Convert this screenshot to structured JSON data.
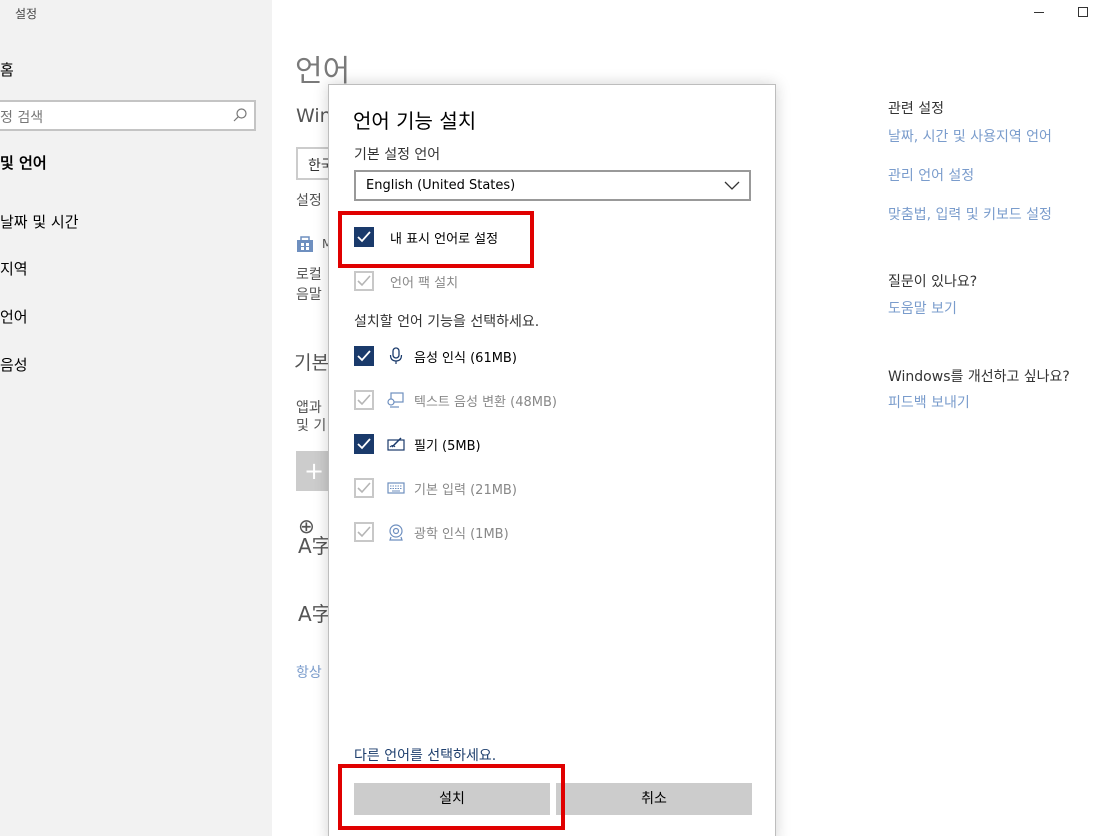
{
  "app": {
    "title": "설정"
  },
  "sidebar": {
    "home": "홈",
    "search_placeholder": "정 검색",
    "section": "및 언어",
    "items": [
      "날짜 및 시간",
      "지역",
      "언어",
      "음성"
    ]
  },
  "main": {
    "title": "언어",
    "windows_display_partial": "Win",
    "select_partial": "한국",
    "settings_partial": "설정",
    "store_partial": "M",
    "local_line1": "로컬",
    "local_line2": "음말",
    "preferred_partial": "기본",
    "apps_line1": "앱과",
    "apps_line2": "및 기",
    "always_partial": "항상"
  },
  "right": {
    "related_title": "관련 설정",
    "links": [
      "날짜, 시간 및 사용지역 언어",
      "관리 언어 설정",
      "맞춤법, 입력 및 키보드 설정"
    ],
    "question_title": "질문이 있나요?",
    "help_link": "도움말 보기",
    "improve_title": "Windows를 개선하고 싶나요?",
    "feedback_link": "피드백 보내기"
  },
  "dialog": {
    "title": "언어 기능 설치",
    "preferred_label": "기본 설정 언어",
    "preferred_value": "English (United States)",
    "set_display": {
      "label": "내 표시 언어로 설정",
      "checked": true,
      "enabled": true
    },
    "install_pack": {
      "label": "언어 팩 설치",
      "checked": true,
      "enabled": false
    },
    "features_label": "설치할 언어 기능을 선택하세요.",
    "features": [
      {
        "label": "음성 인식 (61MB)",
        "checked": true,
        "enabled": true,
        "icon": "microphone-icon"
      },
      {
        "label": "텍스트 음성 변환 (48MB)",
        "checked": true,
        "enabled": false,
        "icon": "text-to-speech-icon"
      },
      {
        "label": "필기 (5MB)",
        "checked": true,
        "enabled": true,
        "icon": "handwriting-icon"
      },
      {
        "label": "기본 입력 (21MB)",
        "checked": true,
        "enabled": false,
        "icon": "keyboard-icon"
      },
      {
        "label": "광학 인식 (1MB)",
        "checked": true,
        "enabled": false,
        "icon": "ocr-icon"
      }
    ],
    "other_language_link": "다른 언어를 선택하세요.",
    "install_button": "설치",
    "cancel_button": "취소"
  },
  "colors": {
    "accent": "#1a3a6b",
    "highlight": "#e00000",
    "link": "#7a9ccc"
  }
}
